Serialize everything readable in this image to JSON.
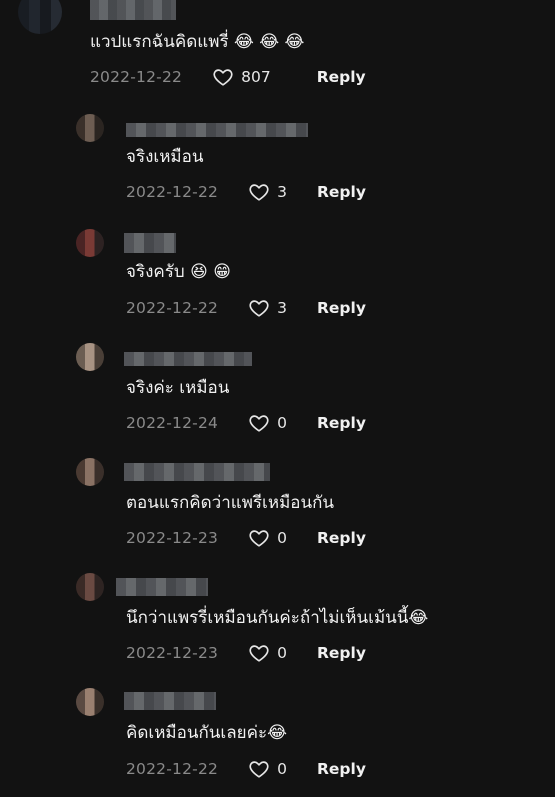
{
  "top_comment": {
    "text": "แวปแรกฉันคิดแพรี่ 😂 😂 😂",
    "date": "2022-12-22",
    "likes": "807",
    "reply_label": "Reply"
  },
  "replies": [
    {
      "text": "จริงเหมือน",
      "date": "2022-12-22",
      "likes": "3",
      "reply_label": "Reply"
    },
    {
      "text": "จริงครับ 😆 😁",
      "date": "2022-12-22",
      "likes": "3",
      "reply_label": "Reply"
    },
    {
      "text": "จริงค่ะ เหมือน",
      "date": "2022-12-24",
      "likes": "0",
      "reply_label": "Reply"
    },
    {
      "text": "ตอนแรกคิดว่าแพรีเหมือนกัน",
      "date": "2022-12-23",
      "likes": "0",
      "reply_label": "Reply"
    },
    {
      "text": "นึกว่าแพรรี่เหมือนกันค่ะถ้าไม่เห็นเม้นนี้😂",
      "date": "2022-12-23",
      "likes": "0",
      "reply_label": "Reply"
    },
    {
      "text": "คิดเหมือนกันเลยค่ะ😂",
      "date": "2022-12-22",
      "likes": "0",
      "reply_label": "Reply"
    }
  ],
  "icons": {
    "like": "heart-outline-icon"
  },
  "colors": {
    "background": "#121212",
    "date": "#8a8a8a",
    "text": "#f1f1f1"
  }
}
